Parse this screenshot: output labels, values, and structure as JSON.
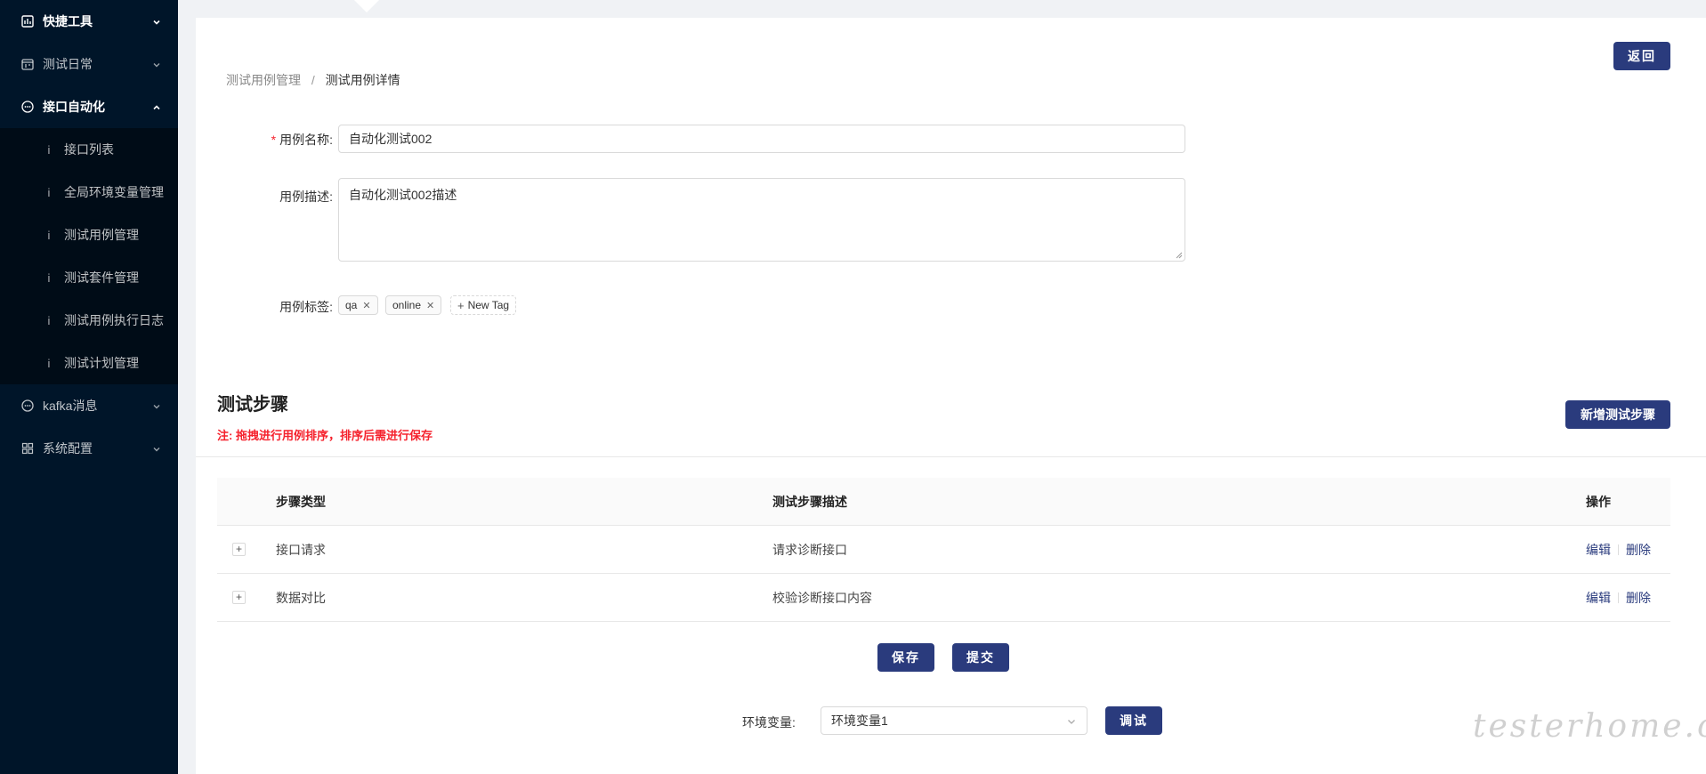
{
  "sidebar": {
    "items": [
      {
        "label": "快捷工具",
        "icon": "chart-icon",
        "expanded": false
      },
      {
        "label": "测试日常",
        "icon": "calendar-icon",
        "expanded": false
      },
      {
        "label": "接口自动化",
        "icon": "message-icon",
        "expanded": true
      },
      {
        "label": "kafka消息",
        "icon": "message-icon",
        "expanded": false
      },
      {
        "label": "系统配置",
        "icon": "grid-icon",
        "expanded": false
      }
    ],
    "submenu": [
      "接口列表",
      "全局环境变量管理",
      "测试用例管理",
      "测试套件管理",
      "测试用例执行日志",
      "测试计划管理"
    ],
    "submenu_marker": "i"
  },
  "breadcrumb": {
    "parent": "测试用例管理",
    "separator": "/",
    "current": "测试用例详情"
  },
  "header": {
    "back_label": "返回"
  },
  "form": {
    "name_label": "用例名称:",
    "name_value": "自动化测试002",
    "desc_label": "用例描述:",
    "desc_value": "自动化测试002描述",
    "tags_label": "用例标签:",
    "tags": [
      "qa",
      "online"
    ],
    "new_tag_label": "New Tag"
  },
  "steps": {
    "title": "测试步骤",
    "note": "注: 拖拽进行用例排序，排序后需进行保存",
    "add_label": "新增测试步骤",
    "columns": [
      "步骤类型",
      "测试步骤描述",
      "操作"
    ],
    "rows": [
      {
        "type": "接口请求",
        "desc": "请求诊断接口"
      },
      {
        "type": "数据对比",
        "desc": "校验诊断接口内容"
      }
    ],
    "edit_label": "编辑",
    "delete_label": "删除"
  },
  "actions": {
    "save_label": "保存",
    "submit_label": "提交"
  },
  "env": {
    "label": "环境变量:",
    "value": "环境变量1",
    "debug_label": "调试"
  },
  "watermark": "testerhome.com",
  "colors": {
    "primary": "#2a3b7d",
    "sidebar": "#001529",
    "danger": "#f5222d"
  }
}
